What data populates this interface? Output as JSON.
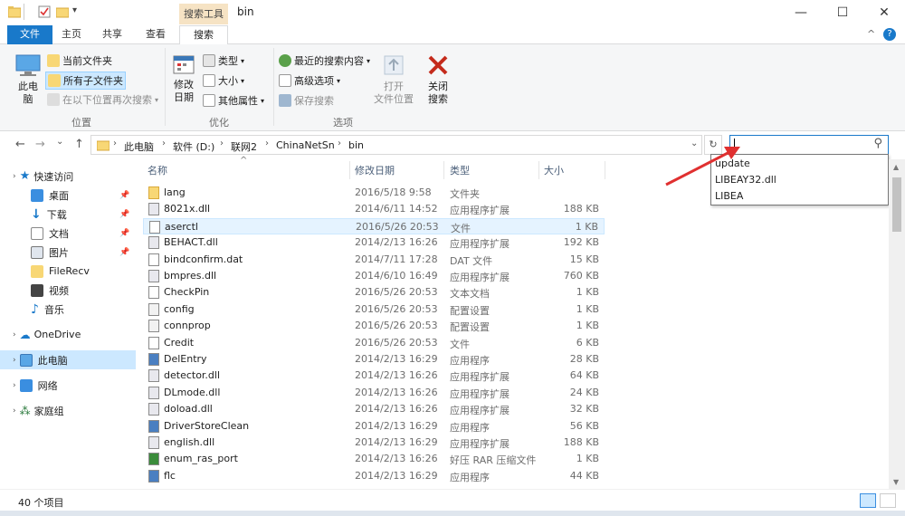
{
  "window": {
    "title": "bin",
    "context_tab": "搜索工具",
    "minimize": "—",
    "maximize": "☐",
    "close": "✕",
    "help": "?",
    "collapse": "^"
  },
  "ribbon_tabs": [
    {
      "label": "文件"
    },
    {
      "label": "主页"
    },
    {
      "label": "共享"
    },
    {
      "label": "查看"
    },
    {
      "label": "搜索"
    }
  ],
  "ribbon": {
    "location": {
      "this_pc": "此电\n脑",
      "current_folder": "当前文件夹",
      "all_subfolders": "所有子文件夹",
      "search_again": "在以下位置再次搜索",
      "group": "位置"
    },
    "refine": {
      "modified_date": "修改\n日期",
      "kind": "类型",
      "size": "大小",
      "other_props": "其他属性",
      "group": "优化"
    },
    "options": {
      "recent_searches": "最近的搜索内容",
      "advanced": "高级选项",
      "save_search": "保存搜索",
      "open_location": "打开\n文件位置",
      "close_search": "关闭\n搜索",
      "group": "选项"
    }
  },
  "nav": {
    "back": "←",
    "forward": "→",
    "history": "⌄",
    "up": "↑",
    "breadcrumb": [
      "此电脑",
      "软件 (D:)",
      "联网2",
      "ChinaNetSn",
      "bin"
    ],
    "refresh": "↻",
    "dropdown": "⌄",
    "search_value": "",
    "search_icon": "⚲"
  },
  "sidebar": [
    {
      "label": "快速访问",
      "icon": "star-icon",
      "pinned": false
    },
    {
      "label": "桌面",
      "icon": "desktop-icon",
      "pinned": true
    },
    {
      "label": "下载",
      "icon": "download-icon",
      "pinned": true
    },
    {
      "label": "文档",
      "icon": "documents-icon",
      "pinned": true
    },
    {
      "label": "图片",
      "icon": "pictures-icon",
      "pinned": true
    },
    {
      "label": "FileRecv",
      "icon": "folder-icon",
      "pinned": false
    },
    {
      "label": "视频",
      "icon": "video-icon",
      "pinned": false
    },
    {
      "label": "音乐",
      "icon": "music-icon",
      "pinned": false
    },
    {
      "label": "OneDrive",
      "icon": "onedrive-icon",
      "pinned": false
    },
    {
      "label": "此电脑",
      "icon": "this-pc-icon",
      "pinned": false
    },
    {
      "label": "网络",
      "icon": "network-icon",
      "pinned": false
    },
    {
      "label": "家庭组",
      "icon": "homegroup-icon",
      "pinned": false
    }
  ],
  "columns": {
    "name": "名称",
    "date": "修改日期",
    "type": "类型",
    "size": "大小",
    "sort": "^"
  },
  "files": [
    {
      "name": "lang",
      "date": "2016/5/18 9:58",
      "type": "文件夹",
      "size": "",
      "icon": "folder"
    },
    {
      "name": "8021x.dll",
      "date": "2014/6/11 14:52",
      "type": "应用程序扩展",
      "size": "188 KB",
      "icon": "dll"
    },
    {
      "name": "aserctl",
      "date": "2016/5/26 20:53",
      "type": "文件",
      "size": "1 KB",
      "icon": "file"
    },
    {
      "name": "BEHACT.dll",
      "date": "2014/2/13 16:26",
      "type": "应用程序扩展",
      "size": "192 KB",
      "icon": "dll"
    },
    {
      "name": "bindconfirm.dat",
      "date": "2014/7/11 17:28",
      "type": "DAT 文件",
      "size": "15 KB",
      "icon": "file"
    },
    {
      "name": "bmpres.dll",
      "date": "2014/6/10 16:49",
      "type": "应用程序扩展",
      "size": "760 KB",
      "icon": "dll"
    },
    {
      "name": "CheckPin",
      "date": "2016/5/26 20:53",
      "type": "文本文档",
      "size": "1 KB",
      "icon": "file"
    },
    {
      "name": "config",
      "date": "2016/5/26 20:53",
      "type": "配置设置",
      "size": "1 KB",
      "icon": "config"
    },
    {
      "name": "connprop",
      "date": "2016/5/26 20:53",
      "type": "配置设置",
      "size": "1 KB",
      "icon": "config"
    },
    {
      "name": "Credit",
      "date": "2016/5/26 20:53",
      "type": "文件",
      "size": "6 KB",
      "icon": "file"
    },
    {
      "name": "DelEntry",
      "date": "2014/2/13 16:29",
      "type": "应用程序",
      "size": "28 KB",
      "icon": "exe"
    },
    {
      "name": "detector.dll",
      "date": "2014/2/13 16:26",
      "type": "应用程序扩展",
      "size": "64 KB",
      "icon": "dll"
    },
    {
      "name": "DLmode.dll",
      "date": "2014/2/13 16:26",
      "type": "应用程序扩展",
      "size": "24 KB",
      "icon": "dll"
    },
    {
      "name": "doload.dll",
      "date": "2014/2/13 16:26",
      "type": "应用程序扩展",
      "size": "32 KB",
      "icon": "dll"
    },
    {
      "name": "DriverStoreClean",
      "date": "2014/2/13 16:29",
      "type": "应用程序",
      "size": "56 KB",
      "icon": "exe"
    },
    {
      "name": "english.dll",
      "date": "2014/2/13 16:29",
      "type": "应用程序扩展",
      "size": "188 KB",
      "icon": "dll"
    },
    {
      "name": "enum_ras_port",
      "date": "2014/2/13 16:26",
      "type": "好压 RAR 压缩文件",
      "size": "1 KB",
      "icon": "rar"
    },
    {
      "name": "flc",
      "date": "2014/2/13 16:29",
      "type": "应用程序",
      "size": "44 KB",
      "icon": "exe"
    }
  ],
  "autocomplete": [
    "update",
    "LIBEAY32.dll",
    "LIBEA"
  ],
  "status": {
    "count": "40 个项目"
  },
  "colors": {
    "accent": "#1979ca",
    "arrow": "#e03030",
    "selection": "#cce8ff",
    "hover": "#e5f3ff"
  }
}
